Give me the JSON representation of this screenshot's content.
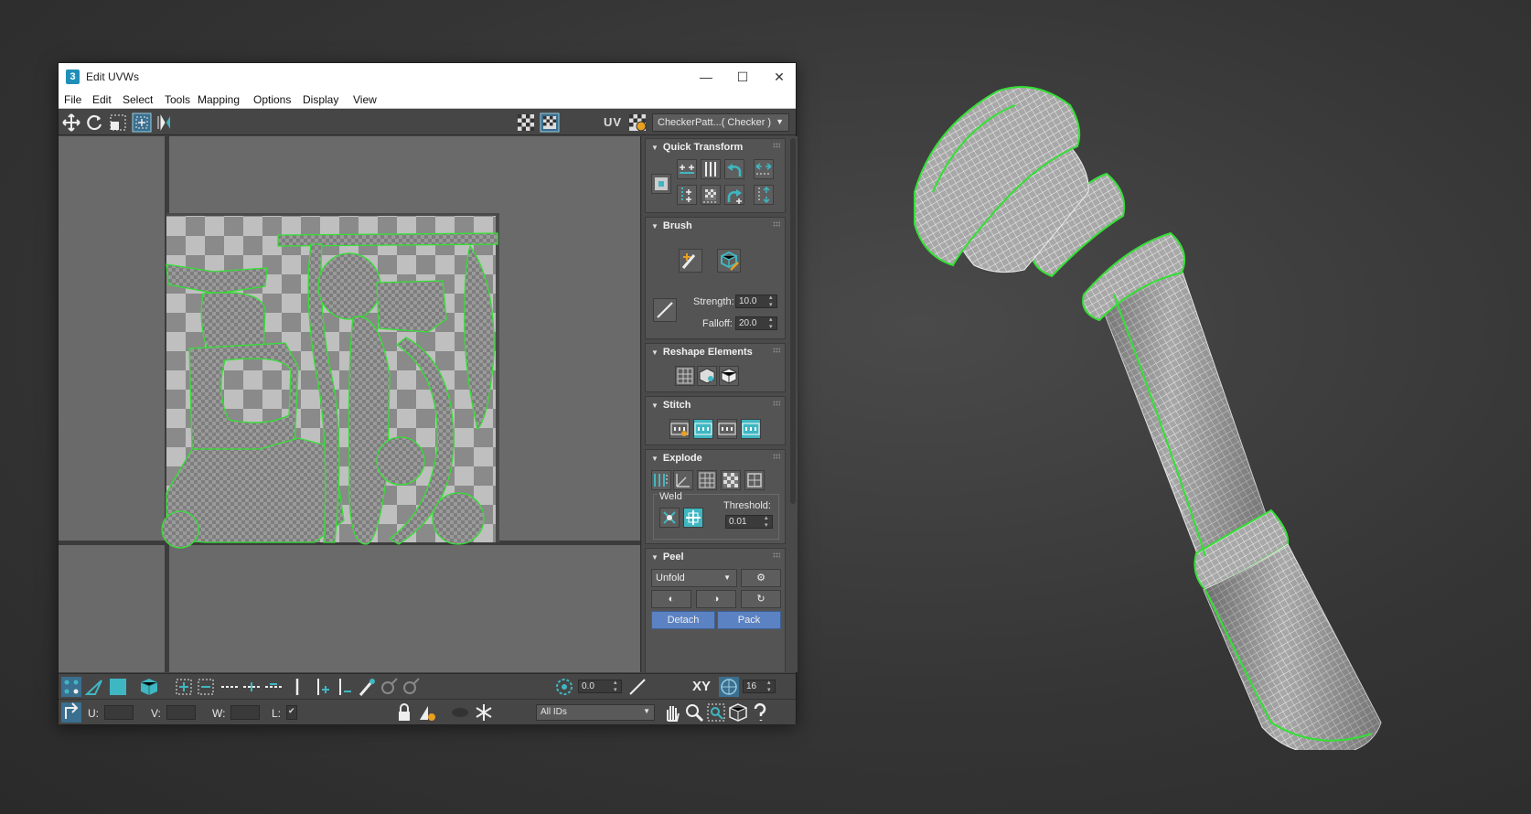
{
  "window": {
    "title": "Edit UVWs",
    "controls": {
      "minimize": "—",
      "maximize": "☐",
      "close": "✕"
    }
  },
  "menu": [
    "File",
    "Edit",
    "Select",
    "Tools",
    "Mapping",
    "Options",
    "Display",
    "View"
  ],
  "toolbar": {
    "uv_label": "UV",
    "texture_dropdown": "CheckerPatt...( Checker )"
  },
  "panel": {
    "quick_transform": {
      "title": "Quick Transform"
    },
    "brush": {
      "title": "Brush",
      "strength_label": "Strength:",
      "strength_value": "10.0",
      "falloff_label": "Falloff:",
      "falloff_value": "20.0"
    },
    "reshape": {
      "title": "Reshape Elements"
    },
    "stitch": {
      "title": "Stitch"
    },
    "explode": {
      "title": "Explode",
      "weld_label": "Weld",
      "threshold_label": "Threshold:",
      "threshold_value": "0.01"
    },
    "peel": {
      "title": "Peel",
      "mode_dropdown": "Unfold",
      "detach_label": "Detach",
      "pack_label": "Pack"
    }
  },
  "bottom": {
    "angle_value": "0.0",
    "xy_label": "XY",
    "grid_value": "16",
    "u_label": "U:",
    "v_label": "V:",
    "w_label": "W:",
    "l_label": "L:",
    "ids_dropdown": "All IDs"
  },
  "colors": {
    "seam": "#33e033",
    "teal_accent": "#3fb7c2",
    "blue_button": "#5b82c2"
  }
}
